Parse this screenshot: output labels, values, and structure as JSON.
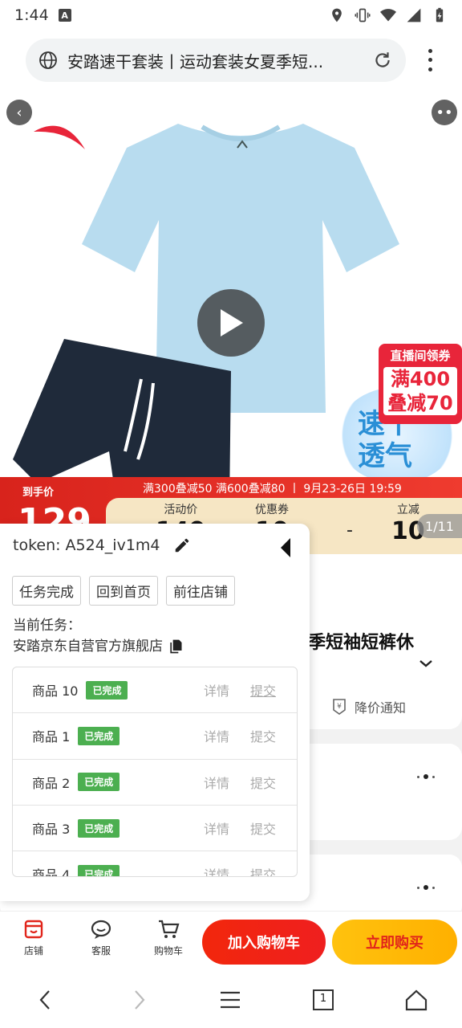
{
  "status_bar": {
    "time": "1:44",
    "notif_icon_letter": "A"
  },
  "browser": {
    "url_text": "安踏速干套装丨运动套装女夏季短袖短裤休闲T恤",
    "url_display": "安踏速干套装丨运动套装女夏季短..."
  },
  "hero": {
    "live_promo_title": "直播间领券",
    "live_promo_line1": "满400",
    "live_promo_line2": "叠减70",
    "speed_text_1": "速干",
    "speed_text_2": "透气",
    "page_indicator": "1/11"
  },
  "price_banner": {
    "to_hand_label": "到手价",
    "promo_line": "满300叠减50  满600叠减80  丨 9月23-26日 19:59",
    "big_price": "129",
    "cols": [
      {
        "label": "活动价",
        "value": "149"
      },
      {
        "label": "优惠券",
        "value": "10"
      },
      {
        "label": "立减",
        "value": "10"
      }
    ],
    "minus": "-"
  },
  "under": {
    "title_fragment": "季短袖短裤休",
    "price_notice": "降价通知"
  },
  "panel": {
    "token_label": "token:",
    "token_value": "A524_iv1m4",
    "buttons": [
      "任务完成",
      "回到首页",
      "前往店铺"
    ],
    "task_label": "当前任务：",
    "task_shop": "安踏京东自营官方旗舰店",
    "detail_label": "详情",
    "submit_label": "提交",
    "tasks": [
      {
        "name": "商品 10",
        "status": "已完成"
      },
      {
        "name": "商品 1",
        "status": "已完成"
      },
      {
        "name": "商品 2",
        "status": "已完成"
      },
      {
        "name": "商品 3",
        "status": "已完成"
      },
      {
        "name": "商品 4",
        "status": "已完成"
      }
    ]
  },
  "bottom_bar": {
    "shop": "店铺",
    "service": "客服",
    "cart": "购物车",
    "add_to_cart": "加入购物车",
    "buy_now": "立即购买"
  },
  "nav_bar": {
    "tab_count": "1"
  },
  "colors": {
    "accent_red": "#e1251b",
    "accent_yellow": "#ffc20e",
    "status_green": "#4caf50"
  }
}
